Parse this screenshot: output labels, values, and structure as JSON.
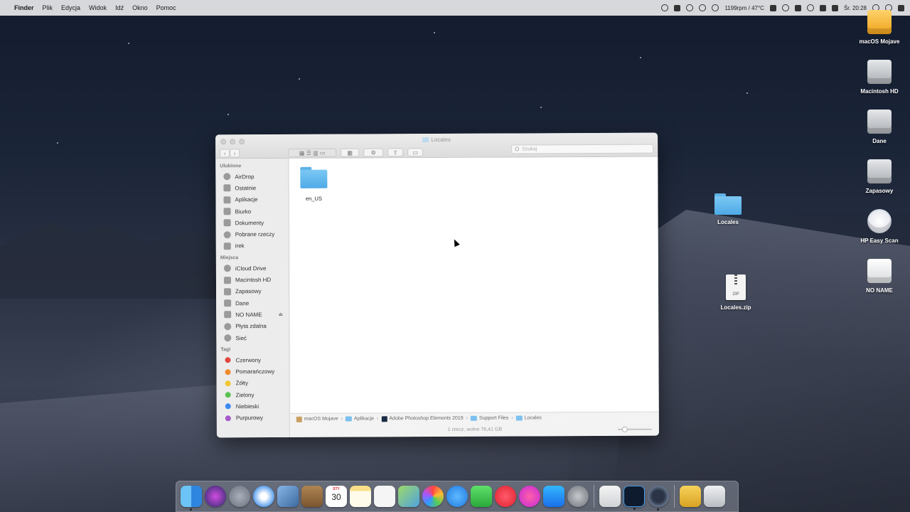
{
  "menubar": {
    "app_name": "Finder",
    "items": [
      "Plik",
      "Edycja",
      "Widok",
      "Idź",
      "Okno",
      "Pomoc"
    ],
    "status_fan": "1199rpm / 47°C",
    "clock": "Śr. 20:28"
  },
  "desktop_icons": [
    {
      "label": "macOS Mojave",
      "icon": "orange-disk-icon"
    },
    {
      "label": "Macintosh HD",
      "icon": "hard-disk-icon"
    },
    {
      "label": "Dane",
      "icon": "hard-disk-icon"
    },
    {
      "label": "Zapasowy",
      "icon": "hard-disk-icon"
    },
    {
      "label": "HP Easy Scan",
      "icon": "scanner-app-icon"
    },
    {
      "label": "NO NAME",
      "icon": "external-disk-icon"
    },
    {
      "label": "Locales",
      "icon": "folder-icon"
    },
    {
      "label": "Locales.zip",
      "icon": "zip-file-icon"
    }
  ],
  "zip_badge": "ZIP",
  "finder": {
    "title": "Locales",
    "search_placeholder": "Szukaj",
    "sidebar": {
      "favorites_header": "Ulubione",
      "favorites": [
        "AirDrop",
        "Ostatnie",
        "Aplikacje",
        "Biurko",
        "Dokumenty",
        "Pobrane rzeczy",
        "irek"
      ],
      "places_header": "Miejsca",
      "places": [
        "iCloud Drive",
        "Macintosh HD",
        "Zapasowy",
        "Dane",
        "NO NAME",
        "Płyta zdalna",
        "Sieć"
      ],
      "tags_header": "Tagi",
      "tags": [
        {
          "name": "Czerwony",
          "color": "#e0483e"
        },
        {
          "name": "Pomarańczowy",
          "color": "#f08a2c"
        },
        {
          "name": "Żółty",
          "color": "#f3c531"
        },
        {
          "name": "Zielony",
          "color": "#5ac153"
        },
        {
          "name": "Niebieski",
          "color": "#3d8af0"
        },
        {
          "name": "Purpurowy",
          "color": "#a659c9"
        }
      ]
    },
    "files": [
      {
        "name": "en_US",
        "icon": "folder-icon"
      }
    ],
    "path": [
      "macOS Mojave",
      "Aplikacje",
      "Adobe Photoshop Elements 2019",
      "Support Files",
      "Locales"
    ],
    "status": "1 rzecz, wolne 76,41 GB"
  },
  "dock": {
    "calendar_month": "STY",
    "calendar_day": "30"
  }
}
